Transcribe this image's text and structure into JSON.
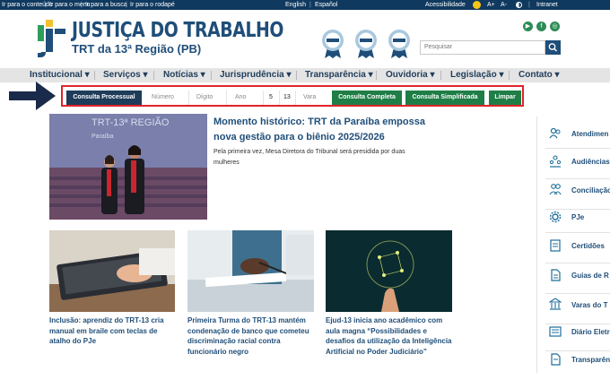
{
  "topbar": {
    "skip_links": [
      "Ir para o conteúdo",
      "Ir para o menu",
      "Ir para a busca",
      "Ir para o rodapé"
    ],
    "lang_english": "English",
    "lang_spanish": "Español",
    "accessibility": "Acessibilidade",
    "font_increase": "A+",
    "font_decrease": "A-",
    "intranet": "Intranet"
  },
  "header": {
    "title": "JUSTIÇA DO TRABALHO",
    "subtitle": "TRT da 13ª Região (PB)",
    "search_placeholder": "Pesquisar",
    "colors": {
      "brand": "#1f4e79",
      "accent_green": "#2e8b57",
      "topbar": "#10395f"
    }
  },
  "nav": {
    "items": [
      "Institucional",
      "Serviços",
      "Notícias",
      "Jurisprudência",
      "Transparência",
      "Ouvidoria",
      "Legislação",
      "Contato"
    ]
  },
  "consulta": {
    "processual_label": "Consulta Processual",
    "numero_placeholder": "Número",
    "digito_placeholder": "Dígito",
    "ano_placeholder": "Ano",
    "justica_value": "5",
    "regiao_value": "13",
    "vara_placeholder": "Vara",
    "completa_label": "Consulta Completa",
    "simplificada_label": "Consulta Simplificada",
    "limpar_label": "Limpar"
  },
  "hero": {
    "title": "Momento histórico: TRT da Paraíba empossa nova gestão para o biênio 2025/2026",
    "description": "Pela primeira vez, Mesa Diretora do Tribunal será presidida por duas mulheres",
    "image_text_line1": "TRT-13ª REGIÃO",
    "image_text_line2": "Paraíba"
  },
  "news": [
    {
      "title": "Inclusão: aprendiz do TRT-13 cria manual em braile com teclas de atalho do PJe"
    },
    {
      "title": "Primeira Turma do TRT-13 mantém condenação de banco que cometeu discriminação racial contra funcionário negro"
    },
    {
      "title": "Ejud-13 inicia ano acadêmico com aula magna “Possibilidades e desafios da utilização da Inteligência Artificial no Poder Judiciário”"
    }
  ],
  "sidebar": {
    "items": [
      {
        "label": "Atendimen",
        "icon": "people-icon"
      },
      {
        "label": "Audiências",
        "icon": "audience-icon"
      },
      {
        "label": "Conciliação",
        "icon": "handshake-icon"
      },
      {
        "label": "PJe",
        "icon": "gear-icon"
      },
      {
        "label": "Certidões",
        "icon": "certificate-icon"
      },
      {
        "label": "Guias de R",
        "icon": "document-icon"
      },
      {
        "label": "Varas do T",
        "icon": "building-icon"
      },
      {
        "label": "Diário Eletr",
        "icon": "newspaper-icon"
      },
      {
        "label": "Transparên",
        "icon": "document-icon"
      }
    ]
  }
}
